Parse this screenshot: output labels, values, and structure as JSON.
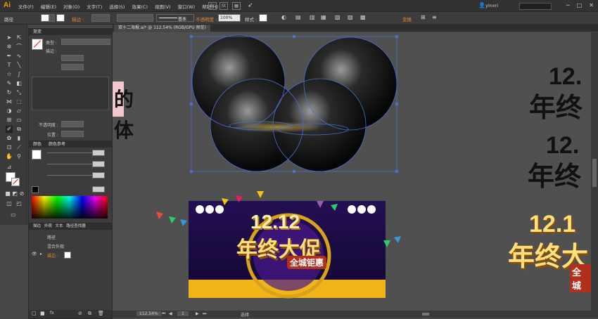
{
  "app": {
    "logo": "Ai"
  },
  "menu": {
    "items": [
      "文件(F)",
      "编辑(E)",
      "对象(O)",
      "文字(T)",
      "选择(S)",
      "效果(C)",
      "视图(V)",
      "窗口(W)",
      "帮助(H)"
    ],
    "user": "yinxri",
    "mode_buttons": [
      "Br",
      "St"
    ]
  },
  "controlbar": {
    "selection_label": "路径",
    "stroke_label": "描边 :",
    "brush_label": "基本",
    "opacity_label": "不透明度 :",
    "opacity_value": "100%",
    "style_label": "样式 :",
    "transform_label": "变换"
  },
  "document": {
    "tab_title": "双十二海报.ai* @ 112.54% (RGB/GPU 预览)"
  },
  "panels": {
    "gradient": {
      "tab": "渐变",
      "type_label": "类型 :",
      "stroke_label": "描边 :",
      "opacity_label": "不透明度 :",
      "position_label": "位置 :"
    },
    "color": {
      "tabs": [
        "颜色",
        "颜色参考"
      ]
    },
    "appearance": {
      "tabs": [
        "描边",
        "外观",
        "文本",
        "路径查找器"
      ],
      "rows": [
        "路径",
        "混合外观",
        "描边 :"
      ]
    }
  },
  "status": {
    "zoom": "112.54%",
    "page": "1",
    "tool_mode": "选择"
  },
  "artwork": {
    "sidebar_glyphs": [
      "的",
      "体"
    ],
    "poster_date": "12.12",
    "poster_title": "年终大促",
    "poster_subtitle": "全城钜惠",
    "right_date_1": "12.",
    "right_title_1": "年终",
    "right_date_2": "12.",
    "right_title_2": "年终",
    "right_date_3": "12.1",
    "right_title_3": "年终大",
    "right_sub_3": "全城"
  },
  "colors": {
    "accent": "#ff9a00",
    "poster_bg": "#1a0b40",
    "gold": "#f5c321",
    "selection": "#4a6fd1"
  }
}
